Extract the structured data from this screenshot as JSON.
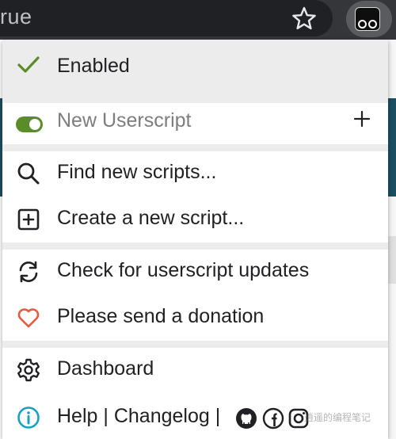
{
  "browser": {
    "url_text": "rue",
    "bookmark_icon": "star-icon",
    "extension_icon": "tampermonkey-icon"
  },
  "menu": {
    "enabled_label": "Enabled",
    "new_userscript_label": "New Userscript",
    "find_label": "Find new scripts...",
    "create_label": "Create a new script...",
    "check_label": "Check for userscript updates",
    "donate_label": "Please send a donation",
    "dashboard_label": "Dashboard",
    "help_label": "Help",
    "separator": "|",
    "changelog_label": "Changelog",
    "social_icons": [
      "github-icon",
      "facebook-icon",
      "instagram-icon"
    ]
  },
  "colors": {
    "accent_green": "#5b8c2a",
    "heart_red": "#e55b3c",
    "info_teal": "#1aa0c4",
    "toolbar": "#35363a",
    "urlbar": "#202124"
  },
  "watermark": "逍遥的编程笔记"
}
